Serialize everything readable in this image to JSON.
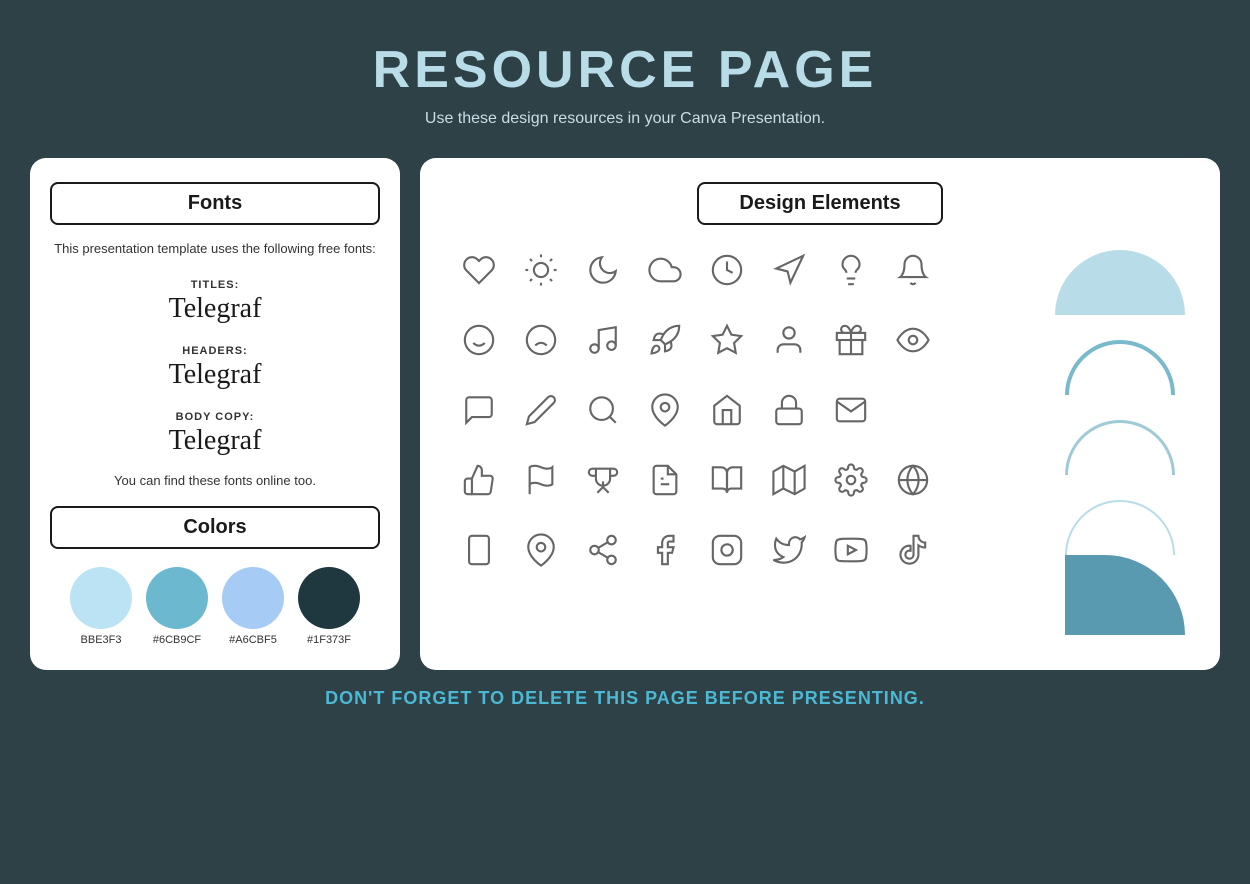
{
  "header": {
    "title": "RESOURCE PAGE",
    "subtitle": "Use these design resources in your Canva Presentation."
  },
  "left_panel": {
    "fonts_label": "Fonts",
    "fonts_description": "This presentation template uses the following free fonts:",
    "font_entries": [
      {
        "label": "TITLES:",
        "name": "Telegraf"
      },
      {
        "label": "HEADERS:",
        "name": "Telegraf"
      },
      {
        "label": "BODY COPY:",
        "name": "Telegraf"
      }
    ],
    "fonts_online_note": "You can find these fonts online too.",
    "colors_label": "Colors",
    "swatches": [
      {
        "color": "#BBE3F3",
        "label": "BBE3F3"
      },
      {
        "color": "#6CB9CF",
        "label": "#6CB9CF"
      },
      {
        "color": "#A6CBF5",
        "label": "#A6CBF5"
      },
      {
        "color": "#1F373F",
        "label": "#1F373F"
      }
    ]
  },
  "right_panel": {
    "design_elements_label": "Design Elements"
  },
  "footer": {
    "text": "DON'T FORGET TO DELETE THIS PAGE BEFORE PRESENTING."
  }
}
